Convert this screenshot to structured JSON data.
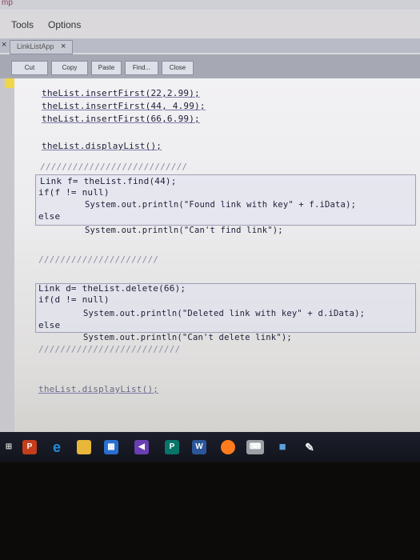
{
  "window": {
    "title_fragment": "mp"
  },
  "menu": {
    "items": [
      "Tools",
      "Options"
    ]
  },
  "tab": {
    "label": "LinkListApp",
    "close": "×",
    "left_close": "×"
  },
  "toolbar": {
    "buttons": [
      "Cut",
      "Copy",
      "Paste",
      "Find...",
      "Close"
    ]
  },
  "code": {
    "lines": [
      "theList.insertFirst(22,2.99);",
      "theList.insertFirst(44, 4.99);",
      "theList.insertFirst(66,6.99);",
      "theList.displayList();",
      "///////////////////////////",
      "Link f= theList.find(44);",
      "if(f != null)",
      "System.out.println(\"Found link with key\" + f.iData);",
      "else",
      "System.out.println(\"Can't find link\");",
      "//////////////////////",
      "Link d= theList.delete(66);",
      "if(d != null)",
      "System.out.println(\"Deleted link with key\" + d.iData);",
      "else",
      "System.out.println(\"Can't delete link\");",
      "//////////////////////////",
      "theList.displayList();"
    ]
  },
  "taskbar": {
    "icons": [
      "start-icon",
      "powerpoint-icon",
      "edge-icon",
      "file-explorer-icon",
      "store-icon",
      "visual-studio-icon",
      "publisher-icon",
      "word-icon",
      "firefox-icon",
      "keyboard-icon",
      "cube-icon",
      "pen-icon"
    ],
    "labels": {
      "powerpoint": "P",
      "publisher": "P",
      "word": "W"
    },
    "colors": {
      "powerpoint": "#c43e1c",
      "edge": "#1c8fe0",
      "explorer": "#e8b73a",
      "store": "#2a6fd0",
      "vs": "#6a3fb3",
      "publisher": "#077568",
      "word": "#2b579a",
      "firefox": "#ff7b1c"
    }
  }
}
